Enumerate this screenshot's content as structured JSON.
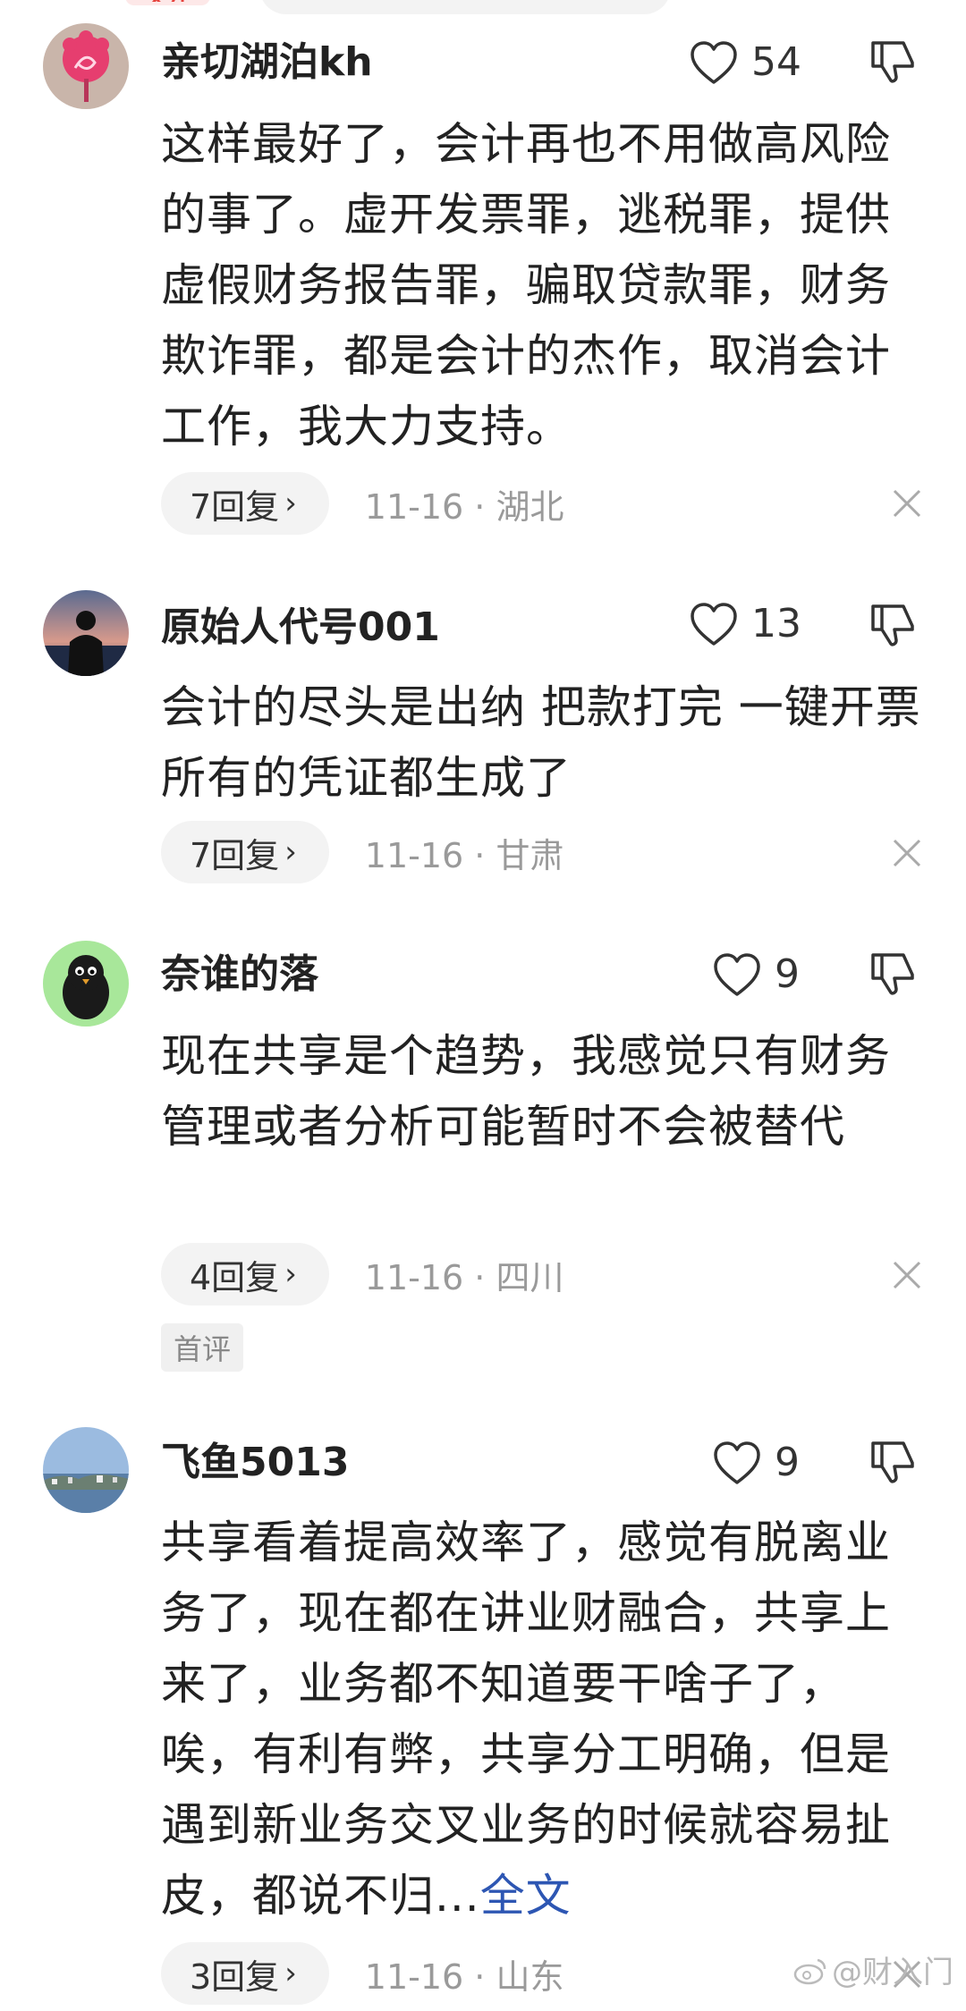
{
  "top_remnant": {
    "badge_text": "关注"
  },
  "comments": [
    {
      "username": "亲切湖泊kh",
      "likes": "54",
      "body": "这样最好了，会计再也不用做高风险的事了。虚开发票罪，逃税罪，提供虚假财务报告罪，骗取贷款罪，财务欺诈罪，都是会计的杰作，取消会计工作，我大力支持。",
      "replies": "7回复",
      "meta": "11-16 · 湖北",
      "avatar_icon": "pink-flower-avatar"
    },
    {
      "username": "原始人代号001",
      "likes": "13",
      "body": "会计的尽头是出纳 把款打完 一键开票 所有的凭证都生成了",
      "replies": "7回复",
      "meta": "11-16 · 甘肃",
      "avatar_icon": "sunset-silhouette-avatar"
    },
    {
      "username": "奈谁的落",
      "likes": "9",
      "body": "现在共享是个趋势，我感觉只有财务管理或者分析可能暂时不会被替代",
      "replies": "4回复",
      "meta": "11-16 · 四川",
      "badge": "首评",
      "avatar_icon": "black-bird-avatar"
    },
    {
      "username": "飞鱼5013",
      "likes": "9",
      "body": "共享看着提高效率了，感觉有脱离业务了，现在都在讲业财融合，共享上来了，业务都不知道要干啥子了，唉，有利有弊，共享分工明确，但是遇到新业务交叉业务的时候就容易扯皮，都说不归...",
      "full_text_link": "全文",
      "replies": "3回复",
      "meta": "11-16 · 山东",
      "avatar_icon": "seaside-landscape-avatar"
    }
  ],
  "watermark": "@财入门",
  "colors": {
    "link": "#2d56b3",
    "meta_gray": "#9a9a9a",
    "pill_bg": "#f3f3f3"
  },
  "icons": {
    "like": "heart-outline-icon",
    "dislike": "thumbs-down-icon",
    "chevron": "chevron-right-icon",
    "close": "close-x-icon",
    "weibo": "weibo-logo-icon"
  }
}
